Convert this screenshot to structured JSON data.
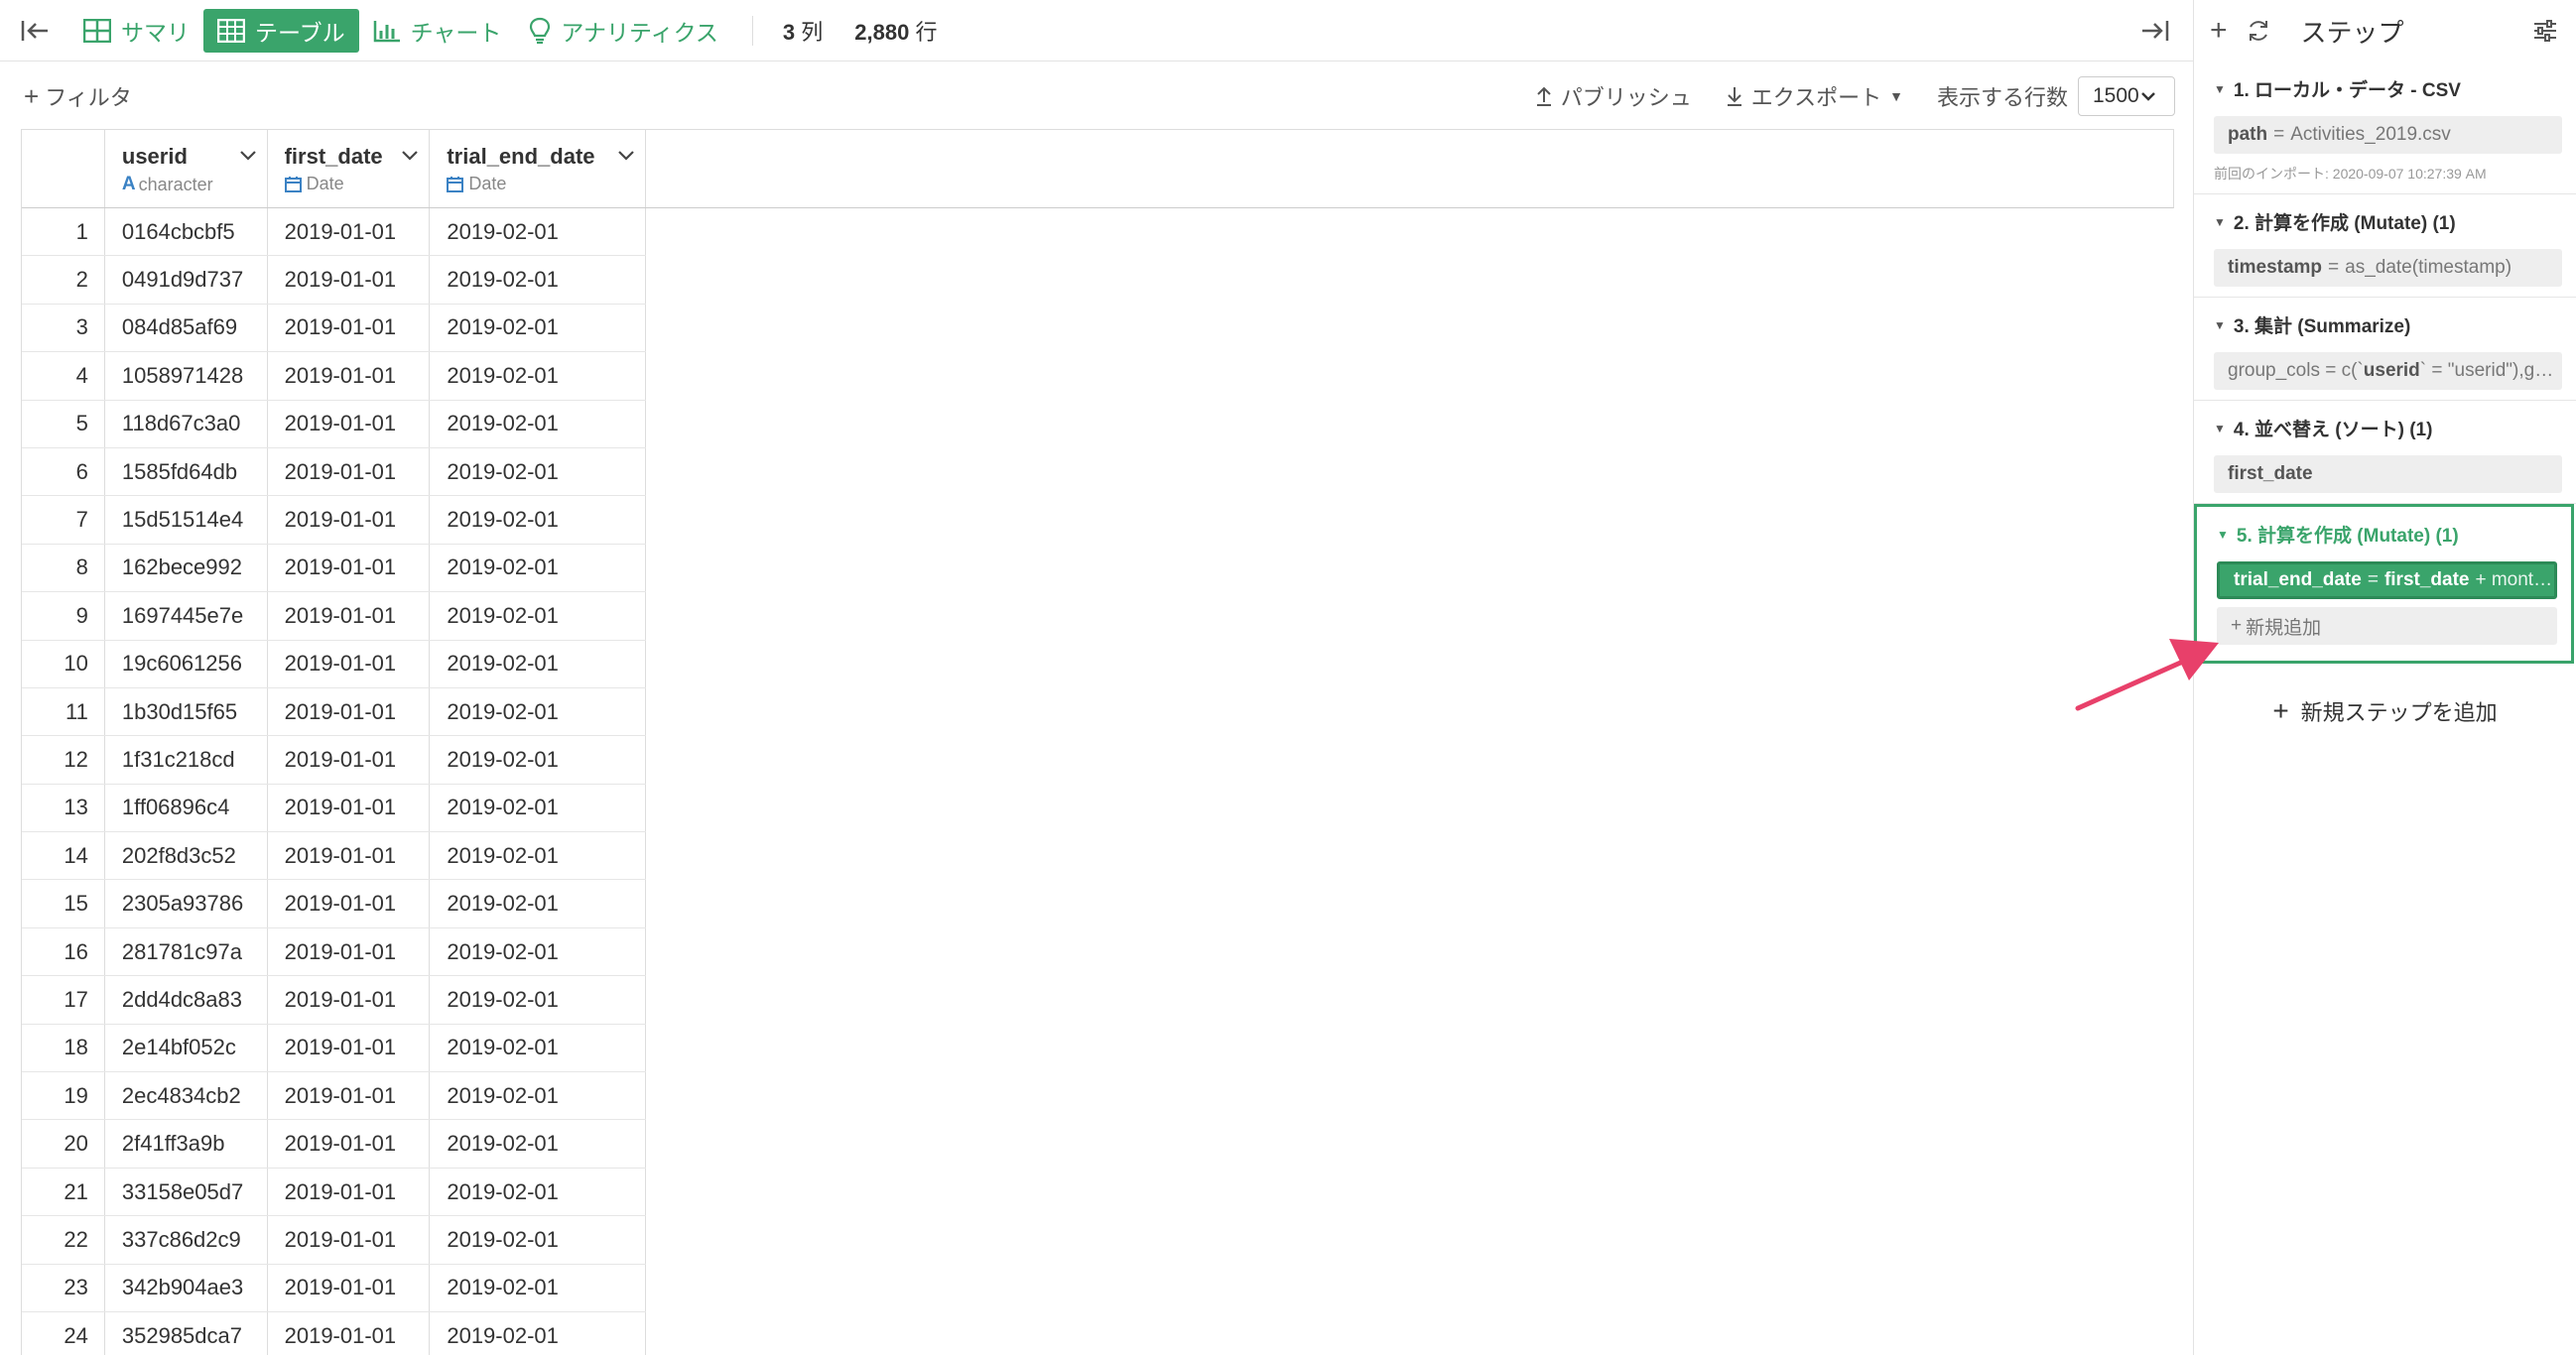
{
  "toolbar": {
    "tabs": [
      {
        "label": "サマリ",
        "icon": "summary-grid-icon"
      },
      {
        "label": "テーブル",
        "icon": "table-icon"
      },
      {
        "label": "チャート",
        "icon": "bar-chart-icon"
      },
      {
        "label": "アナリティクス",
        "icon": "lightbulb-icon"
      }
    ],
    "active_tab": "テーブル",
    "columns_count": "3",
    "columns_unit": "列",
    "rows_count": "2,880",
    "rows_unit": "行",
    "accent_color": "#3aa46b"
  },
  "actionbar": {
    "filter_label": "フィルタ",
    "publish_label": "パブリッシュ",
    "export_label": "エクスポート",
    "rows_label": "表示する行数",
    "rows_value": "1500"
  },
  "table": {
    "columns": [
      {
        "name": "userid",
        "type": "character",
        "type_icon": "A"
      },
      {
        "name": "first_date",
        "type": "Date",
        "type_icon": "calendar-icon"
      },
      {
        "name": "trial_end_date",
        "type": "Date",
        "type_icon": "calendar-icon"
      }
    ],
    "rows": [
      [
        "1",
        "0164cbcbf5",
        "2019-01-01",
        "2019-02-01"
      ],
      [
        "2",
        "0491d9d737",
        "2019-01-01",
        "2019-02-01"
      ],
      [
        "3",
        "084d85af69",
        "2019-01-01",
        "2019-02-01"
      ],
      [
        "4",
        "1058971428",
        "2019-01-01",
        "2019-02-01"
      ],
      [
        "5",
        "118d67c3a0",
        "2019-01-01",
        "2019-02-01"
      ],
      [
        "6",
        "1585fd64db",
        "2019-01-01",
        "2019-02-01"
      ],
      [
        "7",
        "15d51514e4",
        "2019-01-01",
        "2019-02-01"
      ],
      [
        "8",
        "162bece992",
        "2019-01-01",
        "2019-02-01"
      ],
      [
        "9",
        "1697445e7e",
        "2019-01-01",
        "2019-02-01"
      ],
      [
        "10",
        "19c6061256",
        "2019-01-01",
        "2019-02-01"
      ],
      [
        "11",
        "1b30d15f65",
        "2019-01-01",
        "2019-02-01"
      ],
      [
        "12",
        "1f31c218cd",
        "2019-01-01",
        "2019-02-01"
      ],
      [
        "13",
        "1ff06896c4",
        "2019-01-01",
        "2019-02-01"
      ],
      [
        "14",
        "202f8d3c52",
        "2019-01-01",
        "2019-02-01"
      ],
      [
        "15",
        "2305a93786",
        "2019-01-01",
        "2019-02-01"
      ],
      [
        "16",
        "281781c97a",
        "2019-01-01",
        "2019-02-01"
      ],
      [
        "17",
        "2dd4dc8a83",
        "2019-01-01",
        "2019-02-01"
      ],
      [
        "18",
        "2e14bf052c",
        "2019-01-01",
        "2019-02-01"
      ],
      [
        "19",
        "2ec4834cb2",
        "2019-01-01",
        "2019-02-01"
      ],
      [
        "20",
        "2f41ff3a9b",
        "2019-01-01",
        "2019-02-01"
      ],
      [
        "21",
        "33158e05d7",
        "2019-01-01",
        "2019-02-01"
      ],
      [
        "22",
        "337c86d2c9",
        "2019-01-01",
        "2019-02-01"
      ],
      [
        "23",
        "342b904ae3",
        "2019-01-01",
        "2019-02-01"
      ],
      [
        "24",
        "352985dca7",
        "2019-01-01",
        "2019-02-01"
      ]
    ]
  },
  "steps": {
    "title": "ステップ",
    "items": [
      {
        "title": "1. ローカル・データ - CSV",
        "key": "path",
        "value": "Activities_2019.csv",
        "note": "前回のインポート: 2020-09-07 10:27:39 AM"
      },
      {
        "title": "2. 計算を作成 (Mutate) (1)",
        "key": "timestamp",
        "value": "as_date(timestamp)"
      },
      {
        "title": "3. 集計 (Summarize)",
        "key": "group_cols",
        "value": "c(`userid` = \"userid\"),g…",
        "key_prefix": "group_cols = c(`",
        "key_bold": "userid",
        "key_suffix": "` = \"userid\"),g…"
      },
      {
        "title": "4. 並べ替え (ソート) (1)",
        "key": "first_date",
        "value": ""
      },
      {
        "title": "5. 計算を作成 (Mutate) (1)",
        "key": "trial_end_date",
        "key2": "first_date",
        "value": "+ mont…",
        "add_label": "新規追加",
        "active": true
      }
    ],
    "add_step_label": "新規ステップを追加"
  }
}
